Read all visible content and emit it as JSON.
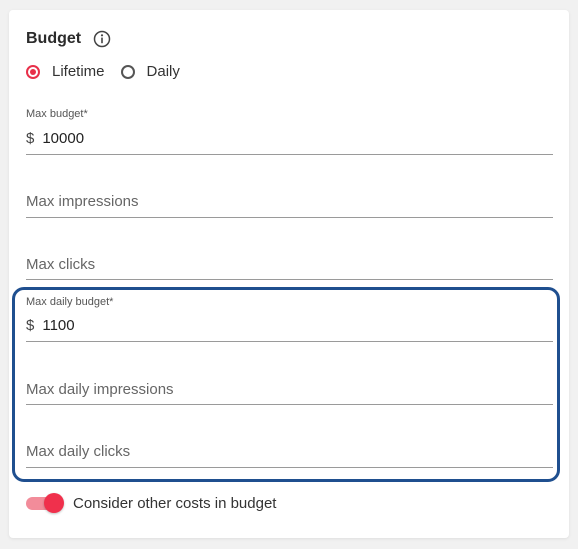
{
  "budget": {
    "title": "Budget",
    "info_icon": "info-circle-icon",
    "type_options": [
      {
        "label": "Lifetime",
        "checked": true
      },
      {
        "label": "Daily",
        "checked": false
      }
    ],
    "accent_color": "#e8304a"
  },
  "fields": {
    "max_budget": {
      "label": "Max budget*",
      "currency": "$",
      "value": "10000"
    },
    "max_impressions": {
      "placeholder": "Max impressions"
    },
    "max_clicks": {
      "placeholder": "Max clicks"
    },
    "max_daily_budget": {
      "label": "Max daily budget*",
      "currency": "$",
      "value": "1100"
    },
    "max_daily_impressions": {
      "placeholder": "Max daily impressions"
    },
    "max_daily_clicks": {
      "placeholder": "Max daily clicks"
    }
  },
  "highlight_color": "#1f4f8f",
  "consider_costs": {
    "label": "Consider other costs in budget",
    "enabled": true
  }
}
